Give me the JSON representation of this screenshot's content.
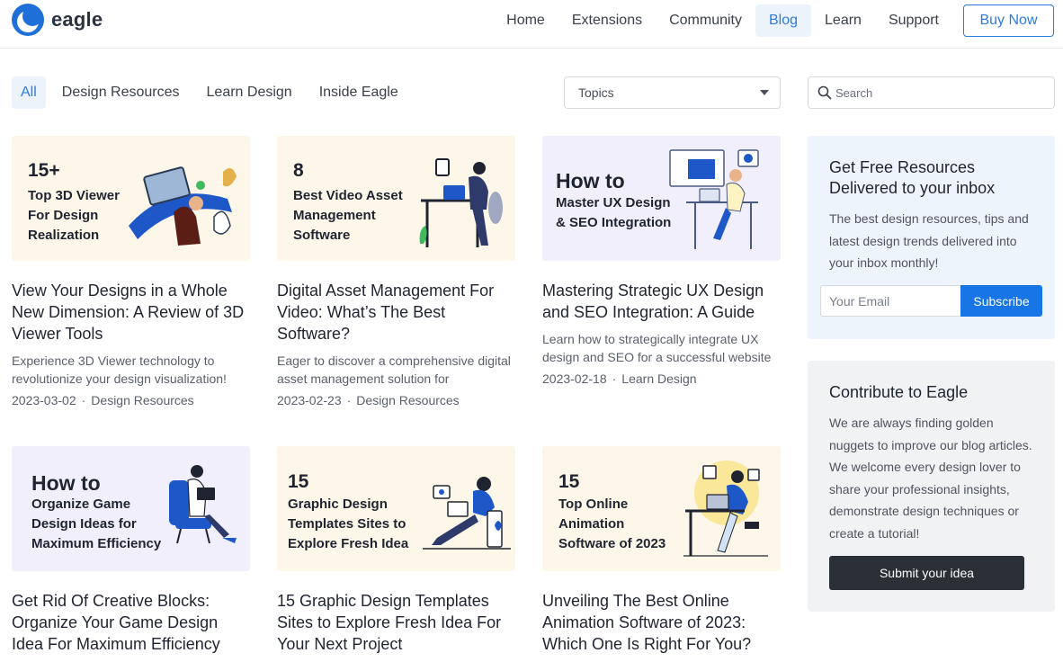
{
  "header": {
    "logo_text": "eagle",
    "nav": [
      "Home",
      "Extensions",
      "Community",
      "Blog",
      "Learn",
      "Support"
    ],
    "active_nav": "Blog",
    "buy_label": "Buy Now"
  },
  "filters": {
    "tabs": [
      "All",
      "Design Resources",
      "Learn Design",
      "Inside Eagle"
    ],
    "active_tab": "All",
    "topics_label": "Topics",
    "search_placeholder": "Search"
  },
  "posts": [
    {
      "thumb_number": "15+",
      "thumb_lines": [
        "Top 3D Viewer",
        "For Design",
        "Realization"
      ],
      "title": "View Your Designs in a Whole New Dimension: A Review of 3D Viewer Tools",
      "excerpt": "Experience 3D Viewer technology to revolutionize your design visualization!",
      "date": "2023-03-02",
      "category": "Design Resources"
    },
    {
      "thumb_number": "8",
      "thumb_lines": [
        "Best Video Asset",
        "Management",
        "Software"
      ],
      "title": "Digital Asset Management For Video: What’s The Best Software?",
      "excerpt": "Eager to discover a comprehensive digital asset management solution for",
      "date": "2023-02-23",
      "category": "Design Resources"
    },
    {
      "thumb_number": "How to",
      "thumb_lines": [
        "Master UX Design",
        "& SEO Integration"
      ],
      "title": "Mastering Strategic UX Design and SEO Integration: A Guide",
      "excerpt": "Learn how to strategically integrate UX design and SEO for a successful website",
      "date": "2023-02-18",
      "category": "Learn Design"
    },
    {
      "thumb_number": "How to",
      "thumb_lines": [
        "Organize Game",
        "Design Ideas for",
        "Maximum Efficiency"
      ],
      "title": "Get Rid Of Creative Blocks: Organize Your Game Design Idea For Maximum Efficiency"
    },
    {
      "thumb_number": "15",
      "thumb_lines": [
        "Graphic Design",
        "Templates Sites to",
        "Explore Fresh Idea"
      ],
      "title": "15 Graphic Design Templates Sites to Explore Fresh Idea For Your Next Project"
    },
    {
      "thumb_number": "15",
      "thumb_lines": [
        "Top Online",
        "Animation",
        "Software of 2023"
      ],
      "title": "Unveiling The Best Online Animation Software of 2023: Which One Is Right For You?"
    }
  ],
  "newsletter": {
    "title": "Get Free Resources Delivered to your inbox",
    "text": "The best design resources, tips and latest design trends delivered into your inbox monthly!",
    "email_placeholder": "Your Email",
    "subscribe_label": "Subscribe"
  },
  "contribute": {
    "title": "Contribute to Eagle",
    "text": "We are always finding golden nuggets to improve our blog articles. We welcome every design lover to share your professional insights, demonstrate design techniques or create a tutorial!",
    "button_label": "Submit your idea"
  },
  "colors": {
    "accent": "#2d7be0",
    "subscribe": "#1875e5",
    "dark_button": "#2b2f36"
  }
}
